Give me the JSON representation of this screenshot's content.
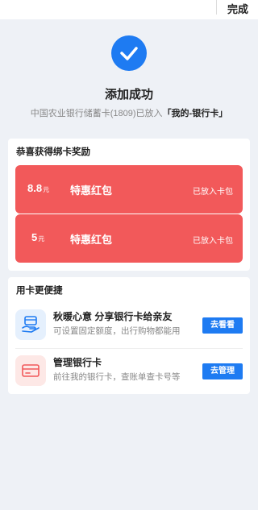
{
  "topbar": {
    "done_label": "完成"
  },
  "success": {
    "icon": "check-icon",
    "title": "添加成功",
    "sub_prefix": "中国农业银行储蓄卡(1809)已放入",
    "sub_target": "「我的-银行卡」"
  },
  "rewards": {
    "title": "恭喜获得绑卡奖励",
    "items": [
      {
        "amount": "8.8",
        "unit": "元",
        "name": "特惠红包",
        "status": "已放入卡包"
      },
      {
        "amount": "5",
        "unit": "元",
        "name": "特惠红包",
        "status": "已放入卡包"
      }
    ]
  },
  "quick": {
    "title": "用卡更便捷",
    "items": [
      {
        "icon": "hand-card-icon",
        "title": "秋暖心意 分享银行卡给亲友",
        "desc": "可设置固定额度，出行购物都能用",
        "button": "去看看"
      },
      {
        "icon": "bank-card-icon",
        "title": "管理银行卡",
        "desc": "前往我的银行卡，查账单查卡号等",
        "button": "去管理"
      }
    ]
  },
  "colors": {
    "accent": "#1e7bf2",
    "reward_red": "#f2595a",
    "background": "#eef1f6"
  }
}
